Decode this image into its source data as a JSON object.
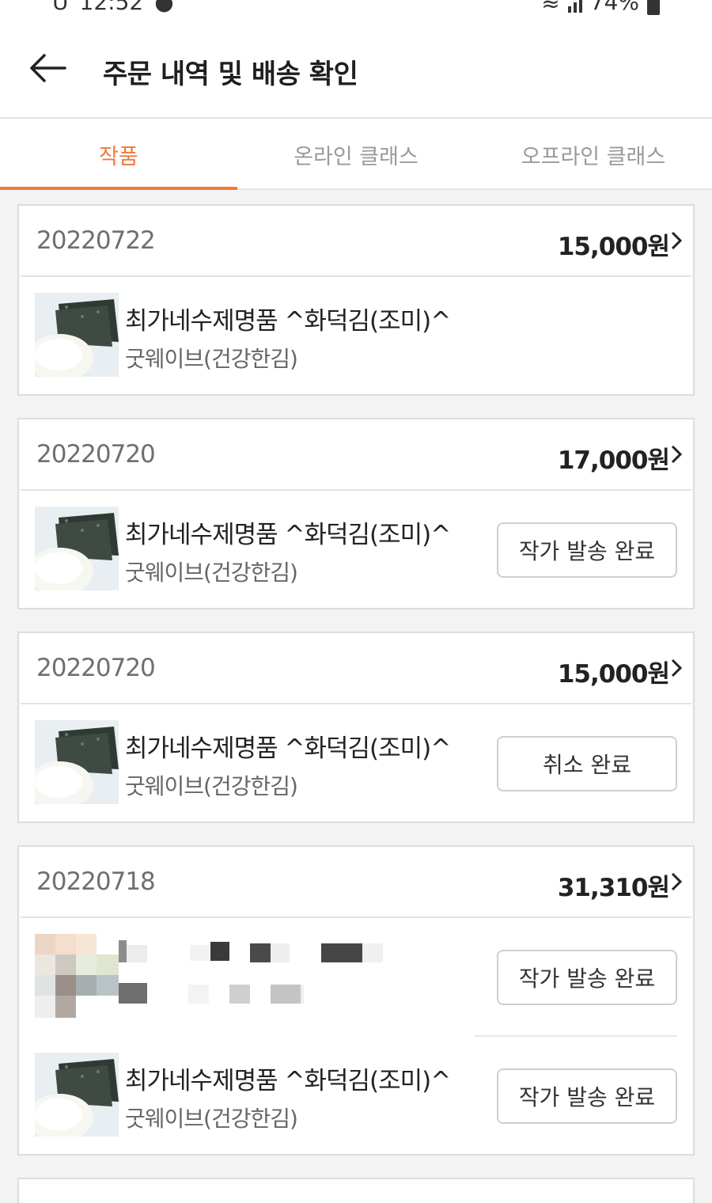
{
  "status_bar": {
    "carrier": "U",
    "time": "12:52",
    "battery": "74%"
  },
  "header": {
    "title": "주문 내역 및 배송 확인"
  },
  "tabs": [
    {
      "label": "작품",
      "active": true
    },
    {
      "label": "온라인 클래스",
      "active": false
    },
    {
      "label": "오프라인 클래스",
      "active": false
    }
  ],
  "orders": [
    {
      "date": "20220722",
      "price": "15,000원",
      "items": [
        {
          "name": "최가네수제명품 ^화덕김(조미)^",
          "seller": "굿웨이브(건강한김)",
          "status": ""
        }
      ]
    },
    {
      "date": "20220720",
      "price": "17,000원",
      "items": [
        {
          "name": "최가네수제명품 ^화덕김(조미)^",
          "seller": "굿웨이브(건강한김)",
          "status": "작가 발송 완료"
        }
      ]
    },
    {
      "date": "20220720",
      "price": "15,000원",
      "items": [
        {
          "name": "최가네수제명품 ^화덕김(조미)^",
          "seller": "굿웨이브(건강한김)",
          "status": "취소 완료"
        }
      ]
    },
    {
      "date": "20220718",
      "price": "31,310원",
      "items": [
        {
          "name": "",
          "seller": "",
          "status": "작가 발송 완료",
          "blurred": true
        },
        {
          "name": "최가네수제명품 ^화덕김(조미)^",
          "seller": "굿웨이브(건강한김)",
          "status": "작가 발송 완료"
        }
      ]
    }
  ],
  "colors": {
    "accent": "#ef7a3b",
    "divider": "#e3e3e3",
    "list_background": "#f3f3f3"
  },
  "icons": [
    "back-arrow-icon",
    "chevron-right-icon",
    "wifi-icon",
    "signal-icon",
    "battery-icon"
  ]
}
